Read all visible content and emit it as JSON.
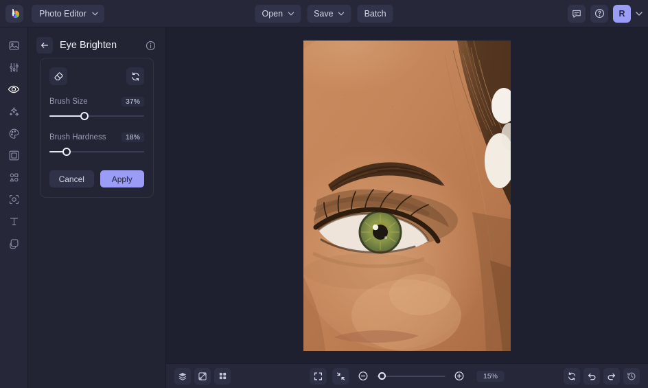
{
  "topbar": {
    "logo_icon": "befunky-logo-icon",
    "app_select_label": "Photo Editor",
    "app_select_chevron_icon": "chevron-down-icon",
    "open_label": "Open",
    "open_chevron_icon": "chevron-down-icon",
    "save_label": "Save",
    "save_chevron_icon": "chevron-down-icon",
    "batch_label": "Batch",
    "feedback_icon": "chat-bubble-icon",
    "help_icon": "question-circle-icon",
    "avatar_initial": "R",
    "account_chevron_icon": "chevron-down-icon",
    "accent_color": "#9a9cf5"
  },
  "rail": {
    "items": [
      {
        "name": "image",
        "icon": "image-icon",
        "active": false
      },
      {
        "name": "edit",
        "icon": "sliders-icon",
        "active": false
      },
      {
        "name": "touch-up",
        "icon": "eye-icon",
        "active": true
      },
      {
        "name": "effects",
        "icon": "sparkles-icon",
        "active": false
      },
      {
        "name": "artsy",
        "icon": "palette-icon",
        "active": false
      },
      {
        "name": "frames",
        "icon": "frame-icon",
        "active": false
      },
      {
        "name": "graphics",
        "icon": "shapes-icon",
        "active": false
      },
      {
        "name": "overlays",
        "icon": "overlay-icon",
        "active": false
      },
      {
        "name": "text",
        "icon": "text-t-icon",
        "active": false
      },
      {
        "name": "layers",
        "icon": "layers-stack-icon",
        "active": false
      }
    ]
  },
  "panel": {
    "back_icon": "arrow-left-icon",
    "title": "Eye Brighten",
    "info_icon": "info-circle-icon",
    "erase_icon": "eraser-icon",
    "reset_icon": "reset-circular-icon",
    "sliders": [
      {
        "label": "Brush Size",
        "value": "37%",
        "percent": 37
      },
      {
        "label": "Brush Hardness",
        "value": "18%",
        "percent": 18
      }
    ],
    "cancel_label": "Cancel",
    "apply_label": "Apply"
  },
  "canvas": {
    "image_alt": "close-up-portrait-of-a-womans-eye-and-brow"
  },
  "bottombar": {
    "layers_icon": "layers-icon",
    "compare_icon": "compare-split-icon",
    "grid_icon": "grid-four-icon",
    "fit_icon": "fit-to-screen-icon",
    "actual_icon": "shrink-to-fit-icon",
    "zoom_out_icon": "minus-circle-icon",
    "zoom_in_icon": "plus-circle-icon",
    "zoom_value": "15%",
    "zoom_percent": 8,
    "reset_icon": "reset-circular-icon",
    "undo_icon": "undo-arrow-icon",
    "redo_icon": "redo-arrow-icon",
    "history_icon": "history-clock-icon"
  }
}
